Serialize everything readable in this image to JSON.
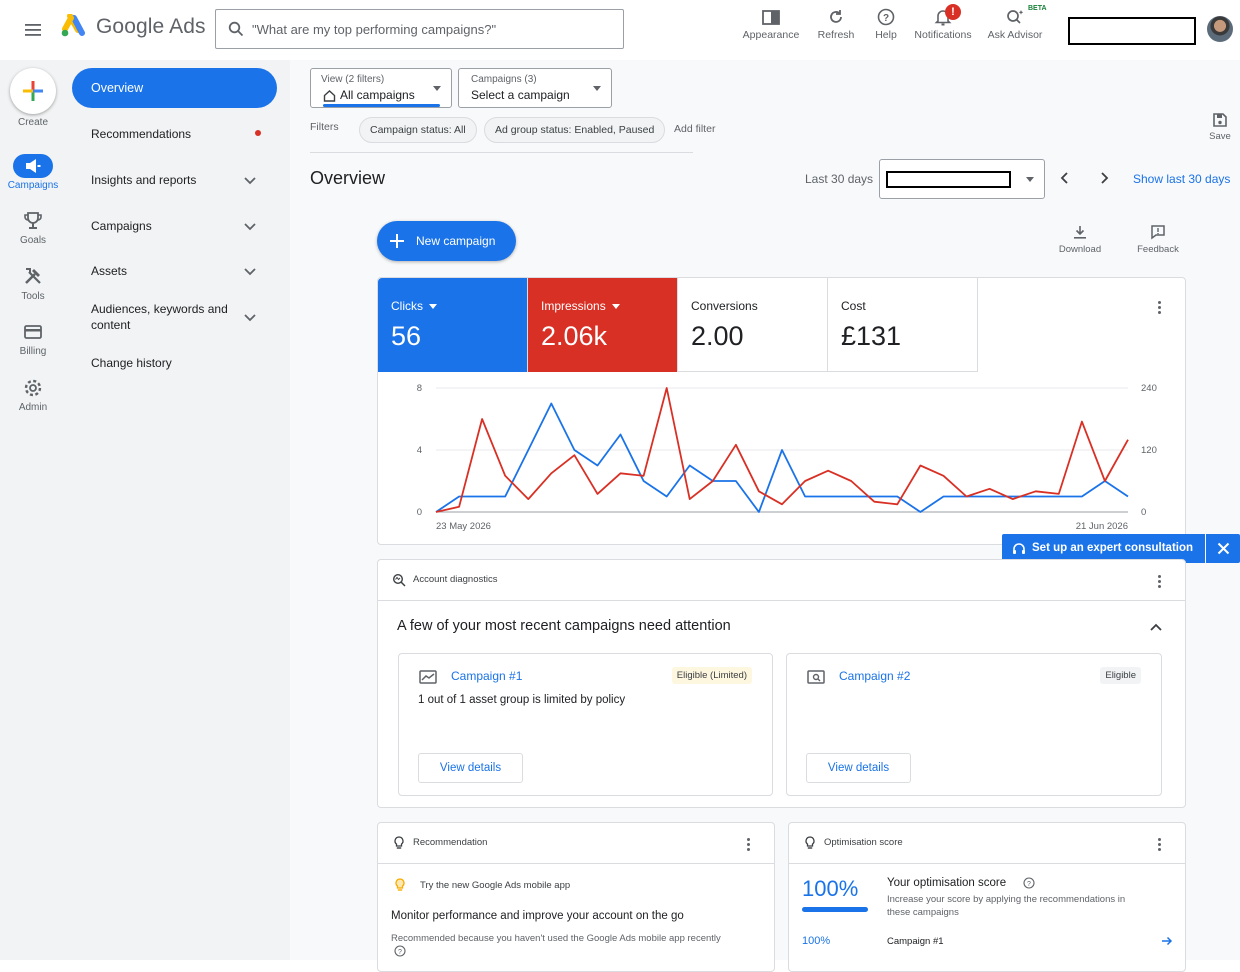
{
  "app": {
    "name": "Google Ads"
  },
  "search": {
    "placeholder": "\"What are my top performing campaigns?\""
  },
  "toolbar": {
    "items": [
      {
        "label": "Appearance",
        "icon": "appearance-icon"
      },
      {
        "label": "Refresh",
        "icon": "refresh-icon"
      },
      {
        "label": "Help",
        "icon": "help-icon"
      },
      {
        "label": "Notifications",
        "icon": "bell-icon",
        "badge": "!"
      },
      {
        "label": "Ask Advisor",
        "icon": "advisor-icon",
        "tag": "BETA"
      }
    ]
  },
  "rail": {
    "create": "Create",
    "items": [
      {
        "label": "Campaigns",
        "icon": "megaphone-icon",
        "active": true
      },
      {
        "label": "Goals",
        "icon": "trophy-icon"
      },
      {
        "label": "Tools",
        "icon": "tools-icon"
      },
      {
        "label": "Billing",
        "icon": "card-icon"
      },
      {
        "label": "Admin",
        "icon": "gear-icon"
      }
    ]
  },
  "nav": {
    "active": "Overview",
    "items": [
      {
        "label": "Recommendations",
        "dot": true
      },
      {
        "label": "Insights and reports",
        "expand": true
      },
      {
        "label": "Campaigns",
        "expand": true
      },
      {
        "label": "Assets",
        "expand": true
      },
      {
        "label": "Audiences, keywords and",
        "label2": "content",
        "expand": true
      },
      {
        "label": "Change history"
      }
    ]
  },
  "filters": {
    "view": {
      "small": "View (2 filters)",
      "value": "All campaigns"
    },
    "campaigns": {
      "small": "Campaigns (3)",
      "value": "Select a campaign"
    },
    "label": "Filters",
    "chips": [
      "Campaign status: All",
      "Ad group status: Enabled, Paused"
    ],
    "add": "Add filter",
    "save": "Save"
  },
  "overview": {
    "title": "Overview",
    "range_label": "Last 30 days",
    "show_last": "Show last 30 days",
    "new_campaign": "New campaign",
    "download": "Download",
    "feedback": "Feedback"
  },
  "metrics": [
    {
      "label": "Clicks",
      "value": "56",
      "color": "#1a73e8"
    },
    {
      "label": "Impressions",
      "value": "2.06k",
      "color": "#d93025"
    },
    {
      "label": "Conversions",
      "value": "2.00"
    },
    {
      "label": "Cost",
      "value": "£131"
    }
  ],
  "chart_data": {
    "type": "line",
    "x_start": "23 May 2026",
    "x_end": "21 Jun 2026",
    "y_left_ticks": [
      "8",
      "4",
      "0"
    ],
    "y_right_ticks": [
      "240",
      "120",
      "0"
    ],
    "ylim_left": [
      0,
      8
    ],
    "ylim_right": [
      0,
      240
    ],
    "grid": true,
    "series": [
      {
        "name": "Clicks",
        "axis": "left",
        "color": "#1a73e8",
        "values": [
          0,
          1,
          1,
          1,
          4,
          7,
          4,
          3,
          5,
          2,
          1,
          3,
          2,
          2,
          0,
          4,
          1,
          1,
          1,
          1,
          1,
          0,
          1,
          1,
          1,
          1,
          1,
          1,
          1,
          2,
          1
        ]
      },
      {
        "name": "Impressions",
        "axis": "right",
        "color": "#d93025",
        "values": [
          0,
          10,
          180,
          70,
          25,
          75,
          110,
          35,
          75,
          70,
          240,
          25,
          60,
          130,
          40,
          15,
          60,
          80,
          60,
          20,
          15,
          90,
          70,
          30,
          45,
          25,
          40,
          35,
          175,
          60,
          140
        ]
      }
    ]
  },
  "expert": {
    "label": "Set up an expert consultation"
  },
  "diagnostics": {
    "title": "Account diagnostics",
    "heading": "A few of your most recent campaigns need attention",
    "campaigns": [
      {
        "name": "Campaign #1",
        "status": "Eligible (Limited)",
        "detail": "1 out of 1 asset group is limited by policy",
        "button": "View details"
      },
      {
        "name": "Campaign #2",
        "status": "Eligible",
        "detail": "",
        "button": "View details"
      }
    ]
  },
  "recommendation": {
    "title": "Recommendation",
    "tip": "Try the new Google Ads mobile app",
    "heading": "Monitor performance and improve your account on the go",
    "reason": "Recommended because you haven't used the Google Ads mobile app recently"
  },
  "optimisation": {
    "title": "Optimisation score",
    "score": "100%",
    "score_fraction": 1.0,
    "label": "Your optimisation score",
    "desc1": "Increase your score by applying the recommendations in",
    "desc2": "these campaigns",
    "row_score": "100%",
    "row_campaign": "Campaign #1"
  }
}
